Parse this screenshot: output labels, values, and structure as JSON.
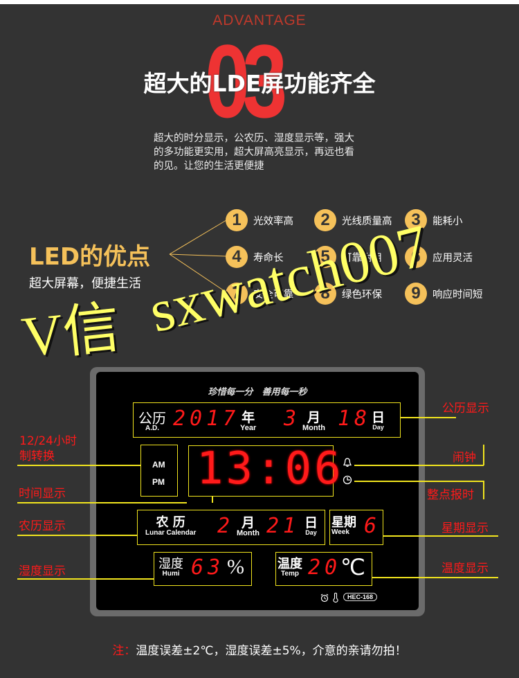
{
  "header": {
    "kicker": "ADVANTAGE",
    "number": "03",
    "headline": "超大的LDE屏功能齐全",
    "intro_lines": [
      "超大的时分显示，公农历、湿度显示等，强大",
      "的多功能更实用，超大屏高亮显示，再远也看",
      "的见。让您的生活更便捷"
    ]
  },
  "led": {
    "title": "LED的优点",
    "subtitle": "超大屏幕，便捷生活",
    "advantages": [
      {
        "num": "1",
        "label": "光效率高"
      },
      {
        "num": "2",
        "label": "光线质量高"
      },
      {
        "num": "3",
        "label": "能耗小"
      },
      {
        "num": "4",
        "label": "寿命长"
      },
      {
        "num": "5",
        "label": "可靠耐用"
      },
      {
        "num": "6",
        "label": "应用灵活"
      },
      {
        "num": "7",
        "label": "安全可靠"
      },
      {
        "num": "8",
        "label": "绿色环保"
      },
      {
        "num": "9",
        "label": "响应时间短"
      }
    ]
  },
  "watermark": {
    "part1": "V信",
    "part2": "sxwatch007"
  },
  "clock": {
    "motto": "珍惜每一分　善用每一秒",
    "solar": {
      "label_cn": "公历",
      "label_en": "A.D.",
      "year": "2017",
      "year_cn": "年",
      "year_en": "Year",
      "month": "3",
      "month_cn": "月",
      "month_en": "Month",
      "day": "18",
      "day_cn": "日",
      "day_en": "Day"
    },
    "ampm": {
      "am": "AM",
      "pm": "PM"
    },
    "time": "13:06",
    "lunar": {
      "label_cn": "农 历",
      "label_en": "Lunar Calendar",
      "month": "2",
      "month_cn": "月",
      "month_en": "Month",
      "day": "21",
      "day_cn": "日",
      "day_en": "Day"
    },
    "week": {
      "label_cn": "星期",
      "label_en": "Week",
      "value": "6"
    },
    "humidity": {
      "label_cn": "湿度",
      "label_en": "Humi",
      "value": "63",
      "unit": "%"
    },
    "temperature": {
      "label_cn": "温度",
      "label_en": "Temp",
      "value": "20",
      "unit": "℃"
    },
    "model": "HEC-168",
    "icons": [
      "bell-icon",
      "clock-icon",
      "alarm-clock-icon",
      "thermometer-icon"
    ]
  },
  "callouts": {
    "solar": "公历显示",
    "hour_mode_line1": "12/24小时",
    "hour_mode_line2": "制转换",
    "alarm": "闹钟",
    "time": "时间显示",
    "chime": "整点报时",
    "lunar": "农历显示",
    "week": "星期显示",
    "humidity": "湿度显示",
    "temperature": "温度显示"
  },
  "note": {
    "prefix": "注：",
    "text": "温度误差±2℃，湿度误差±5%，介意的亲请勿拍！"
  },
  "colors": {
    "background": "#333333",
    "accent_red": "#ff1a1a",
    "gold": "#f5c15a",
    "callout_line": "#f2e51e",
    "watermark": "#ffff66"
  }
}
